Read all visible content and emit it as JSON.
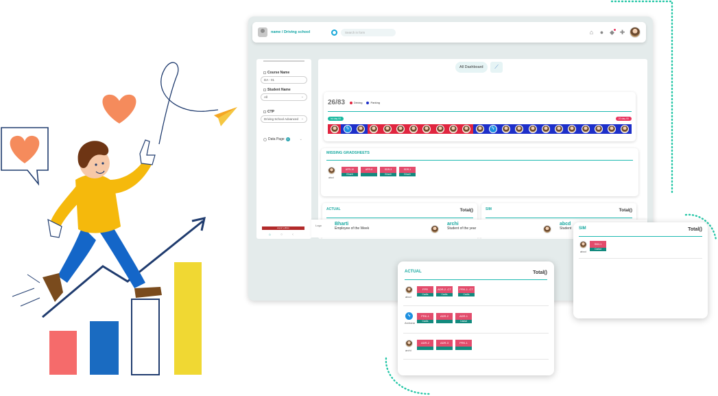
{
  "header": {
    "breadcrumb": "name / Driving school",
    "search_placeholder": "Search in form"
  },
  "sidebar": {
    "course_label": "Course Name",
    "course_value": "DA - 01",
    "student_label": "Student Name",
    "student_value": "All",
    "ctp_label": "CTP",
    "ctp_value": "Driving School Advanced",
    "data_page_label": "Data Page",
    "data_page_badge": "0",
    "footer_strip": "export edition"
  },
  "dashboard": {
    "all_dashboard_label": "All Dashboard",
    "stats_value": "26/83",
    "legend": [
      {
        "label": "Driving",
        "color": "#e0253f"
      },
      {
        "label": "Parking",
        "color": "#1d2fc9"
      }
    ],
    "start_pill": "Ist day 00",
    "end_pill": "20 day 00",
    "track_colors": [
      "#e0253f",
      "#1d2fc9",
      "#1d2fc9",
      "#e0253f",
      "#e0253f",
      "#e0253f",
      "#e0253f",
      "#e0253f",
      "#e0253f",
      "#e0253f",
      "#e0253f",
      "#1d2fc9",
      "#1d2fc9",
      "#1d2fc9",
      "#1d2fc9",
      "#1d2fc9",
      "#1d2fc9",
      "#1d2fc9",
      "#1d2fc9",
      "#1d2fc9",
      "#1d2fc9",
      "#1d2fc9",
      "#1d2fc9"
    ]
  },
  "missing": {
    "title": "MISSING GRADSHEETS",
    "student": "abcd",
    "tags": [
      {
        "top": "APR-10",
        "bottom": "Bharti"
      },
      {
        "top": "APR-8",
        "bottom": ""
      },
      {
        "top": "SDR-3",
        "bottom": "Bharti"
      },
      {
        "top": "SDR-1",
        "bottom": "Bharti"
      }
    ]
  },
  "actual_card": {
    "title": "ACTUAL",
    "total": "Total()"
  },
  "sim_card": {
    "title": "SIM",
    "total": "Total()"
  },
  "employees": [
    {
      "name": "Bharti",
      "role": "Employee of the Week"
    },
    {
      "name": "archi",
      "role": "Student of the year"
    },
    {
      "name": "abcd",
      "role": "Student"
    }
  ],
  "logo_text": "Logo",
  "float_actual": {
    "title": "ACTUAL",
    "total": "Total()",
    "rows": [
      {
        "student": "abcd",
        "tags": [
          {
            "top": "FPR",
            "bottom": "Cadis"
          },
          {
            "top": "ADR-2 -CT",
            "bottom": "Cadis"
          },
          {
            "top": "PRK-1 -CT",
            "bottom": "Cadis"
          }
        ]
      },
      {
        "student": "Archana",
        "tags": [
          {
            "top": "PRK-1",
            "bottom": "Cadis"
          },
          {
            "top": "ADR-2",
            "bottom": ""
          },
          {
            "top": "ADR-1",
            "bottom": "Cadsd"
          }
        ]
      },
      {
        "student": "archi",
        "tags": [
          {
            "top": "ADR-2",
            "bottom": ""
          },
          {
            "top": "ADR-3",
            "bottom": ""
          },
          {
            "top": "PRK-1",
            "bottom": ""
          }
        ]
      }
    ]
  },
  "float_sim": {
    "title": "SIM",
    "total": "Total()",
    "rows": [
      {
        "student": "abcd",
        "tags": [
          {
            "top": "SIM-1",
            "bottom": "Cadsd"
          }
        ]
      }
    ]
  }
}
